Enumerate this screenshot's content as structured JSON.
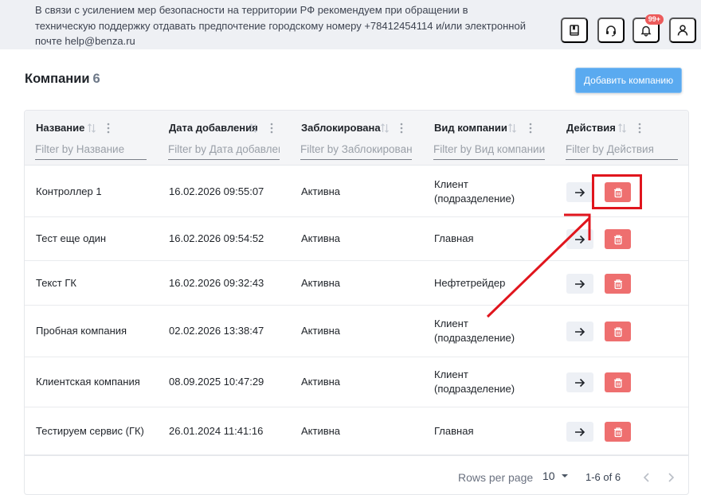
{
  "notice": {
    "text": "В связи с усилением мер безопасности на территории РФ рекомендуем при обращении в техническую поддержку отдавать предпочтение городскому номеру +78412454114 и/или электронной почте help@benza.ru"
  },
  "toolbar": {
    "notifications_badge": "99+",
    "icons": [
      "book-icon",
      "headset-icon",
      "bell-icon",
      "user-icon"
    ]
  },
  "page": {
    "title": "Компании",
    "count": "6",
    "add_button": "Добавить компанию"
  },
  "table": {
    "columns": [
      {
        "label": "Название",
        "placeholder": "Filter by Название"
      },
      {
        "label": "Дата добавления",
        "placeholder": "Filter by Дата добавления"
      },
      {
        "label": "Заблокирована",
        "placeholder": "Filter by Заблокирована"
      },
      {
        "label": "Вид компании",
        "placeholder": "Filter by Вид компании"
      },
      {
        "label": "Действия",
        "placeholder": "Filter by Действия"
      }
    ],
    "rows": [
      {
        "name": "Контроллер 1",
        "date": "16.02.2026 09:55:07",
        "status": "Активна",
        "type": "Клиент (подразделение)"
      },
      {
        "name": "Тест еще один",
        "date": "16.02.2026 09:54:52",
        "status": "Активна",
        "type": "Главная"
      },
      {
        "name": "Текст ГК",
        "date": "16.02.2026 09:32:43",
        "status": "Активна",
        "type": "Нефтетрейдер"
      },
      {
        "name": "Пробная компания",
        "date": "02.02.2026 13:38:47",
        "status": "Активна",
        "type": "Клиент (подразделение)"
      },
      {
        "name": "Клиентская компания",
        "date": "08.09.2025 10:47:29",
        "status": "Активна",
        "type": "Клиент (подразделение)"
      },
      {
        "name": "Тестируем сервис (ГК)",
        "date": "26.01.2024 11:41:16",
        "status": "Активна",
        "type": "Главная"
      }
    ]
  },
  "pagination": {
    "rows_per_page_label": "Rows per page",
    "rows_per_page": "10",
    "range": "1-6 of 6"
  },
  "colors": {
    "accent": "#5aaaf0",
    "danger": "#ee6f6f",
    "annotation": "#e0151d"
  }
}
